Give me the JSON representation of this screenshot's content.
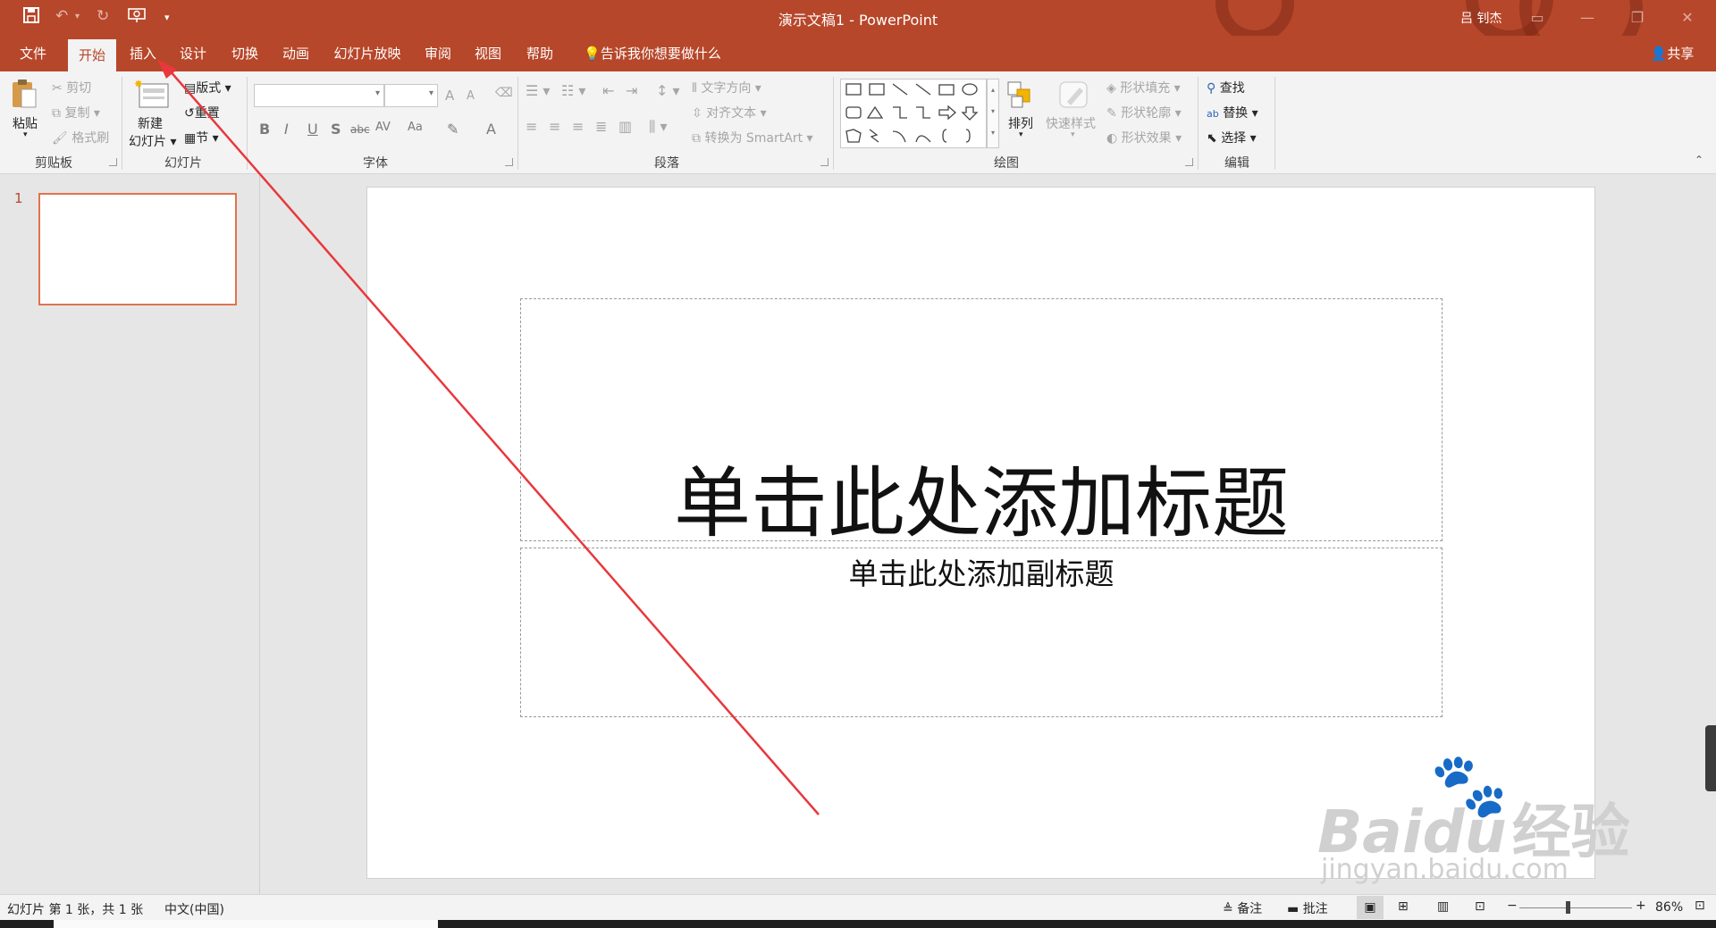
{
  "window": {
    "title": "演示文稿1  -  PowerPoint",
    "user": "吕 钊杰",
    "share": "共享"
  },
  "tabs": [
    "文件",
    "开始",
    "插入",
    "设计",
    "切换",
    "动画",
    "幻灯片放映",
    "审阅",
    "视图",
    "帮助"
  ],
  "tell_me": "告诉我你想要做什么",
  "ribbon": {
    "clipboard": {
      "label": "剪贴板",
      "paste": "粘贴",
      "cut": "剪切",
      "copy": "复制",
      "format_painter": "格式刷"
    },
    "slides": {
      "label": "幻灯片",
      "new_slide_1": "新建",
      "new_slide_2": "幻灯片",
      "layout": "版式",
      "reset": "重置",
      "section": "节"
    },
    "font": {
      "label": "字体",
      "grow": "A",
      "shrink": "A",
      "bold": "B",
      "italic": "I",
      "underline": "U",
      "shadow": "S",
      "strike": "abc",
      "spacing": "AV",
      "case": "Aa",
      "color": "A"
    },
    "paragraph": {
      "label": "段落",
      "text_direction": "文字方向",
      "align_text": "对齐文本",
      "smartart": "转换为 SmartArt"
    },
    "drawing": {
      "label": "绘图",
      "arrange": "排列",
      "quick_styles": "快速样式",
      "fill": "形状填充",
      "outline": "形状轮廓",
      "effects": "形状效果"
    },
    "editing": {
      "label": "编辑",
      "find": "查找",
      "replace": "替换",
      "select": "选择"
    }
  },
  "thumbnails": [
    {
      "number": "1"
    }
  ],
  "slide": {
    "title_placeholder": "单击此处添加标题",
    "subtitle_placeholder": "单击此处添加副标题"
  },
  "status": {
    "slide_info": "幻灯片 第 1 张，共 1 张",
    "language": "中文(中国)",
    "notes": "备注",
    "comments": "批注",
    "zoom": "86%"
  },
  "watermark": {
    "brand": "Baidu",
    "brand_cn": "经验",
    "url": "jingyan.baidu.com"
  },
  "annotation": {
    "color": "#e8383c"
  },
  "colors": {
    "accent": "#b7472a",
    "ribbon_bg": "#f3f3f3"
  }
}
